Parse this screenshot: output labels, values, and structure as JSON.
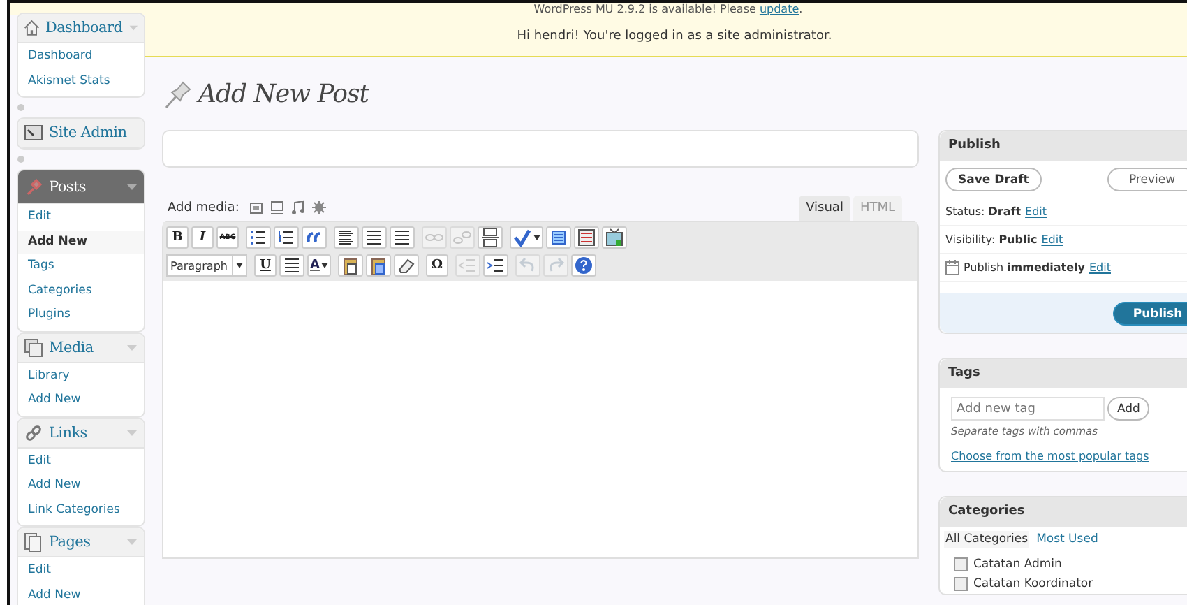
{
  "notices": {
    "update": {
      "text": "WordPress MU 2.9.2 is available! Please ",
      "link": "update",
      "end": "."
    },
    "login": "Hi hendri! You're logged in as a site administrator."
  },
  "sidebar": {
    "groups": [
      {
        "label": "Dashboard",
        "selected": false,
        "items": [
          {
            "label": "Dashboard",
            "selected": false
          },
          {
            "label": "Akismet Stats",
            "selected": false
          }
        ]
      },
      {
        "label": "Site Admin",
        "selected": false
      },
      {
        "label": "Posts",
        "selected": true,
        "items": [
          {
            "label": "Edit",
            "selected": false
          },
          {
            "label": "Add New",
            "selected": true
          },
          {
            "label": "Tags",
            "selected": false
          },
          {
            "label": "Categories",
            "selected": false
          },
          {
            "label": "Plugins",
            "selected": false
          }
        ]
      },
      {
        "label": "Media",
        "selected": false,
        "items": [
          {
            "label": "Library",
            "selected": false
          },
          {
            "label": "Add New",
            "selected": false
          }
        ]
      },
      {
        "label": "Links",
        "selected": false,
        "items": [
          {
            "label": "Edit",
            "selected": false
          },
          {
            "label": "Add New",
            "selected": false
          },
          {
            "label": "Link Categories",
            "selected": false
          }
        ]
      },
      {
        "label": "Pages",
        "selected": false,
        "items": [
          {
            "label": "Edit",
            "selected": false
          },
          {
            "label": "Add New",
            "selected": false
          }
        ]
      }
    ]
  },
  "page_title": "Add New Post",
  "editor": {
    "add_media_label": "Add media:",
    "tabs": [
      {
        "label": "Visual",
        "selected": true
      },
      {
        "label": "HTML",
        "selected": false
      }
    ],
    "toolbar": [
      [
        [
          {
            "kind": "text",
            "label": "B",
            "disabled": false
          },
          {
            "kind": "text",
            "label": "I",
            "disabled": false
          },
          {
            "kind": "text",
            "label": "ABC",
            "disabled": false
          }
        ],
        [
          {
            "kind": "icon",
            "disabled": false
          },
          {
            "kind": "icon",
            "disabled": false
          },
          {
            "kind": "icon",
            "disabled": false
          }
        ],
        [
          {
            "kind": "icon",
            "disabled": false
          },
          {
            "kind": "icon",
            "disabled": false
          },
          {
            "kind": "icon",
            "disabled": false
          }
        ],
        [
          {
            "kind": "icon",
            "disabled": true
          },
          {
            "kind": "icon",
            "disabled": true
          },
          {
            "kind": "icon",
            "disabled": false
          }
        ],
        [
          {
            "kind": "icon",
            "disabled": false
          },
          {
            "kind": "icon",
            "disabled": false
          },
          {
            "kind": "icon",
            "disabled": false
          },
          {
            "kind": "icon",
            "disabled": false
          }
        ]
      ],
      [
        [
          {
            "kind": "select",
            "label": "Paragraph"
          }
        ],
        [
          {
            "kind": "text",
            "label": "U",
            "disabled": false
          },
          {
            "kind": "icon",
            "disabled": false
          },
          {
            "kind": "text",
            "label": "A",
            "disabled": false
          }
        ],
        [
          {
            "kind": "icon",
            "disabled": false
          },
          {
            "kind": "icon",
            "disabled": false
          },
          {
            "kind": "icon",
            "disabled": false
          }
        ],
        [
          {
            "kind": "text",
            "label": "Ω",
            "disabled": false
          }
        ],
        [
          {
            "kind": "icon",
            "disabled": true
          },
          {
            "kind": "icon",
            "disabled": false
          }
        ],
        [
          {
            "kind": "icon",
            "disabled": true
          },
          {
            "kind": "icon",
            "disabled": true
          },
          {
            "kind": "icon",
            "disabled": false
          }
        ]
      ]
    ]
  },
  "publish": {
    "title": "Publish",
    "save_draft": "Save Draft",
    "preview": "Preview",
    "rows": [
      {
        "text": "Status: **Draft**",
        "link": "Edit",
        "icon": false
      },
      {
        "text": "Visibility: **Public**",
        "link": "Edit",
        "icon": false
      },
      {
        "text": "Publish **immediately**",
        "link": "Edit",
        "icon": true
      }
    ],
    "button": "Publish"
  },
  "tags": {
    "title": "Tags",
    "placeholder": "Add new tag",
    "add": "Add",
    "hint": "Separate tags with commas",
    "link": "Choose from the most popular tags"
  },
  "categories": {
    "title": "Categories",
    "tabs": [
      {
        "label": "All Categories",
        "selected": true
      },
      {
        "label": "Most Used",
        "selected": false
      }
    ],
    "items": [
      {
        "label": "Catatan Admin",
        "checked": false
      },
      {
        "label": "Catatan Koordinator",
        "checked": false
      }
    ]
  }
}
